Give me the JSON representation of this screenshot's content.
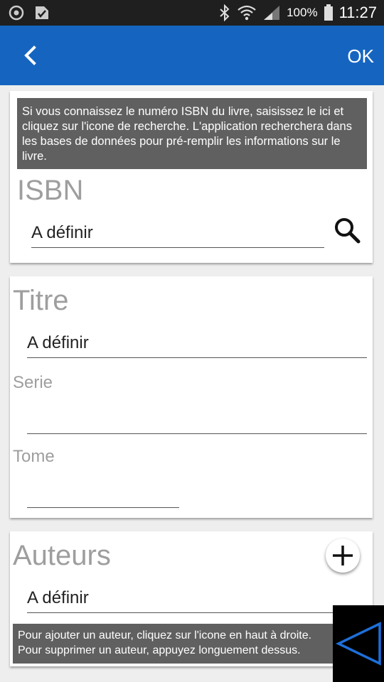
{
  "status_bar": {
    "battery": "100%",
    "time": "11:27",
    "icons": [
      "sync-icon",
      "image-check-icon",
      "bluetooth-icon",
      "wifi-icon",
      "signal-icon",
      "battery-icon"
    ]
  },
  "app_bar": {
    "back_icon": "chevron-left-icon",
    "ok_label": "OK",
    "color": "#1565c0"
  },
  "isbn_card": {
    "hint": "Si vous connaissez le numéro ISBN du livre, saisissez le ici et cliquez sur l'icone de recherche. L'application recherchera dans les bases de données pour pré-remplir les informations sur le livre.",
    "label": "ISBN",
    "value": "A définir",
    "search_icon": "search-icon"
  },
  "title_card": {
    "title_label": "Titre",
    "title_value": "A définir",
    "serie_label": "Serie",
    "serie_value": "",
    "tome_label": "Tome",
    "tome_value": ""
  },
  "authors_card": {
    "label": "Auteurs",
    "value": "A définir",
    "add_icon": "plus-icon",
    "hint": "Pour ajouter un auteur, cliquez sur l'icone en haut à droite. Pour supprimer un auteur, appuyez longuement dessus."
  },
  "nav_overlay": {
    "back_icon": "triangle-back-icon",
    "accent": "#1e6fd9"
  }
}
